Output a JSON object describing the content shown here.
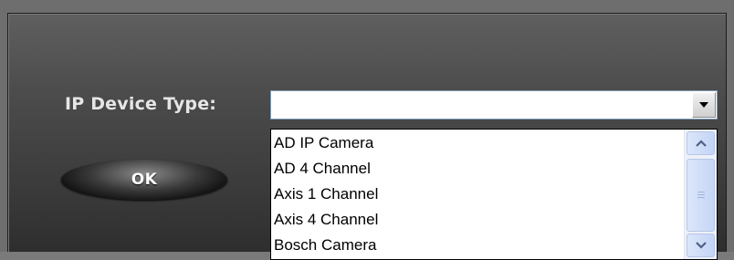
{
  "form": {
    "device_type_label": "IP Device Type:",
    "selected_value": "",
    "ok_label": "OK"
  },
  "dropdown": {
    "items": [
      "AD IP Camera",
      "AD 4 Channel",
      "Axis 1 Channel",
      "Axis 4 Channel",
      "Bosch Camera"
    ]
  },
  "icons": {
    "combo_arrow": "chevron-down-icon",
    "scroll_up": "chevron-up-icon",
    "scroll_down": "chevron-down-icon",
    "scroll_grip": "grip-icon"
  },
  "colors": {
    "panel_dark": "#3a3a3a",
    "label_text": "#e6e6e6",
    "scrollbar_blue": "#c3d4f5"
  }
}
